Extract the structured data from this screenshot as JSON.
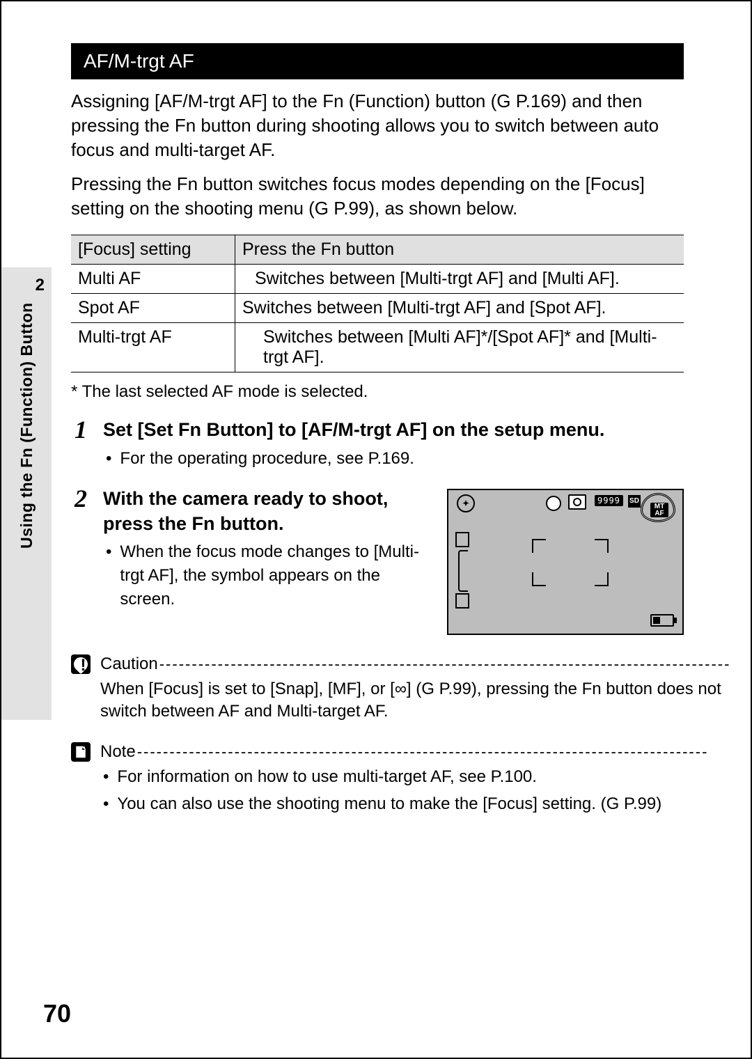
{
  "side": {
    "chapter_num": "2",
    "chapter_title": "Using the Fn (Function) Button"
  },
  "heading": "AF/M-trgt AF",
  "intro1": "Assigning [AF/M-trgt AF] to the Fn (Function) button (G   P.169) and then pressing the Fn button during shooting allows you to switch between auto focus and multi-target AF.",
  "intro2": "Pressing the Fn button switches focus modes depending on the [Focus] setting on the shooting menu (G   P.99), as shown below.",
  "table": {
    "head1": "[Focus] setting",
    "head2": "Press the Fn button",
    "rows": [
      {
        "c1": "Multi AF",
        "c2": "Switches between [Multi-trgt AF] and [Multi AF].",
        "indent": 1
      },
      {
        "c1": "Spot AF",
        "c2": "Switches between [Multi-trgt AF] and [Spot AF].",
        "indent": 0
      },
      {
        "c1": "Multi-trgt AF",
        "c2": "Switches between [Multi AF]*/[Spot AF]* and [Multi-trgt AF].",
        "indent": 2
      }
    ]
  },
  "footnote": "*   The last selected AF mode is selected.",
  "step1": {
    "num": "1",
    "title": "Set [Set Fn Button] to [AF/M-trgt AF] on the setup menu.",
    "bullet": "For the operating procedure, see P.169."
  },
  "step2": {
    "num": "2",
    "title": "With the camera ready to shoot, press the Fn button.",
    "bullet": "When the focus mode changes to [Multi-trgt AF], the symbol appears on the screen."
  },
  "lcd": {
    "count": "9999",
    "sd": "SD",
    "mtaf_line1": "MT",
    "mtaf_line2": "AF"
  },
  "caution": {
    "title": "Caution",
    "text": "When [Focus] is set to [Snap], [MF], or [∞] (G   P.99), pressing the Fn button does not switch between AF and Multi-target AF."
  },
  "note": {
    "title": "Note",
    "bullet1": "For information on how to use multi-target AF, see P.100.",
    "bullet2": "You can also use the shooting menu to make the [Focus] setting. (G   P.99)"
  },
  "page_num": "70",
  "dashes": "----------------------------------------------------------------------------------------"
}
